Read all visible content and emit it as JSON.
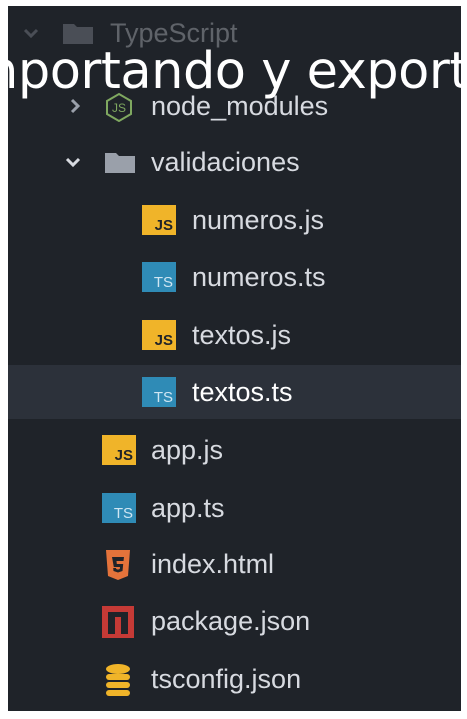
{
  "caption": "nportando y export",
  "tree": {
    "root": {
      "label": "TypeScript"
    },
    "node_modules": {
      "label": "node_modules"
    },
    "validaciones": {
      "label": "validaciones"
    },
    "files": {
      "numeros_js": {
        "label": "numeros.js",
        "icon_text": "JS"
      },
      "numeros_ts": {
        "label": "numeros.ts",
        "icon_text": "TS"
      },
      "textos_js": {
        "label": "textos.js",
        "icon_text": "JS"
      },
      "textos_ts": {
        "label": "textos.ts",
        "icon_text": "TS"
      },
      "app_js": {
        "label": "app.js",
        "icon_text": "JS"
      },
      "app_ts": {
        "label": "app.ts",
        "icon_text": "TS"
      },
      "index_html": {
        "label": "index.html"
      },
      "package_json": {
        "label": "package.json"
      },
      "tsconfig_json": {
        "label": "tsconfig.json"
      }
    }
  },
  "colors": {
    "background": "#1f2329",
    "selected_row": "#2c313a",
    "text": "#d7dae0",
    "js_icon": "#f0b429",
    "ts_icon": "#2f8bb6",
    "html_icon": "#e4733b",
    "npm_icon": "#c53a36",
    "config_icon": "#f0b429",
    "node_icon": "#7fa860",
    "folder_icon": "#9aa0aa"
  },
  "icons": {
    "root": "folder-icon",
    "node_modules": "nodejs-icon",
    "validaciones": "folder-icon",
    "js": "javascript-file-icon",
    "ts": "typescript-file-icon",
    "html": "html5-file-icon",
    "npm": "npm-package-icon",
    "config": "database-config-icon"
  }
}
